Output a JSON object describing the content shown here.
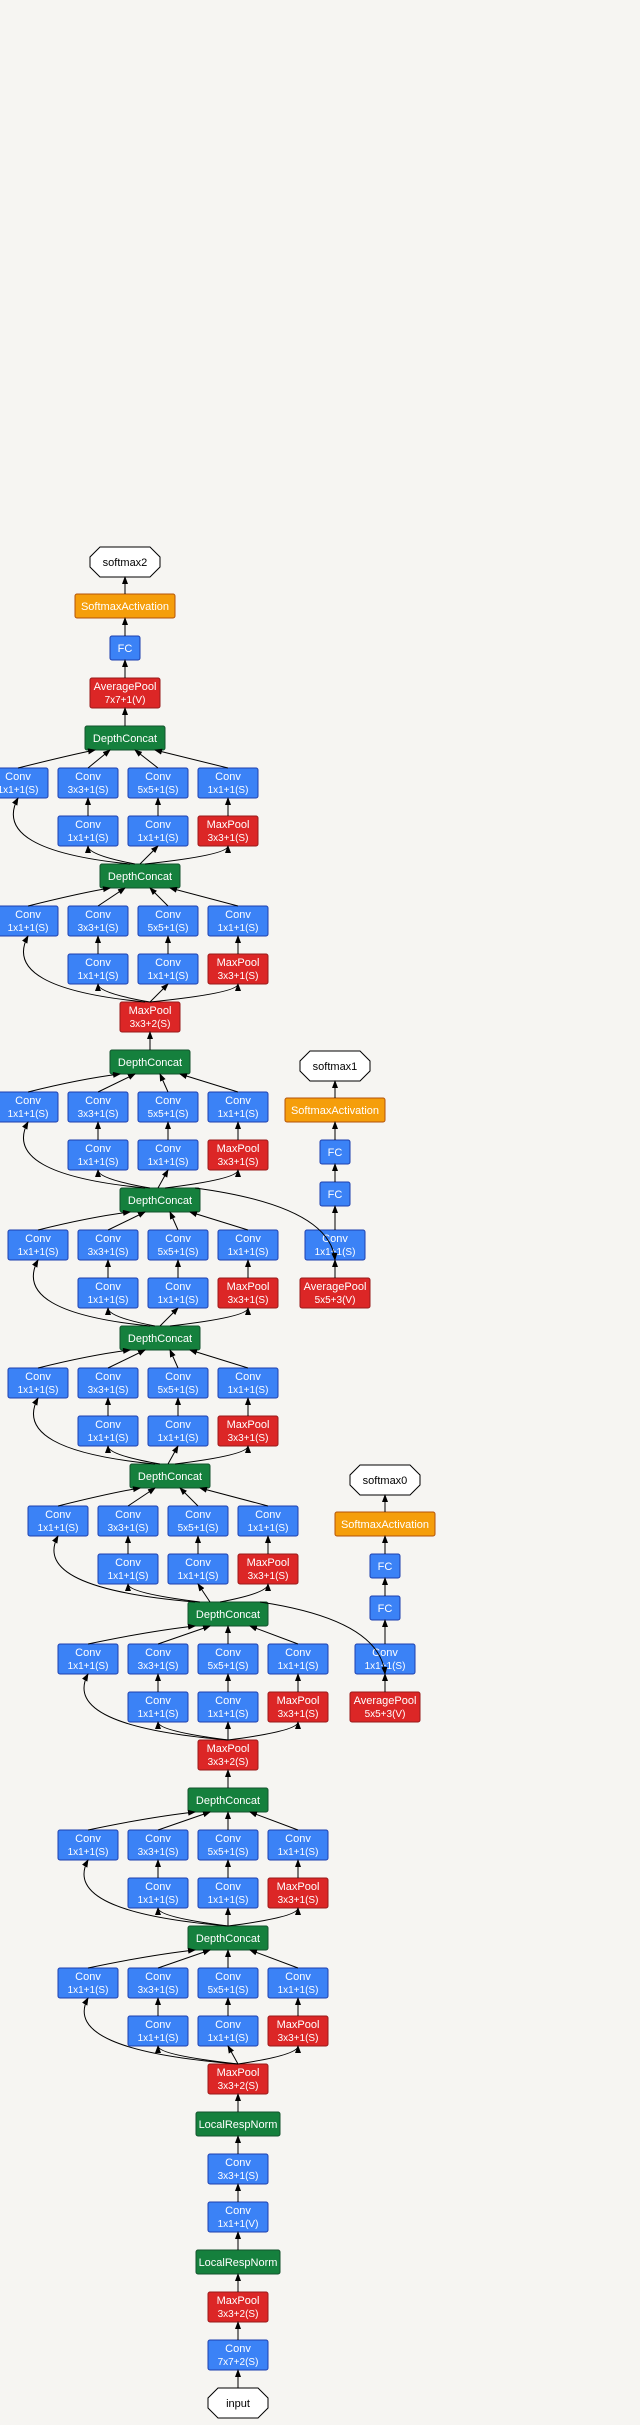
{
  "labels": {
    "input": "input",
    "conv7": "Conv",
    "conv7s": "7x7+2(S)",
    "mp3": "MaxPool",
    "mp3s": "3x3+2(S)",
    "lrn": "LocalRespNorm",
    "conv1": "Conv",
    "conv1s": "1x1+1(V)",
    "conv3": "Conv",
    "conv3s": "3x3+1(S)",
    "dc": "DepthConcat",
    "c1": "Conv",
    "c1s": "1x1+1(S)",
    "c3": "Conv",
    "c3s1": "3x3+1(S)",
    "c5": "Conv",
    "c5s": "5x5+1(S)",
    "mp31": "MaxPool",
    "mp31s": "3x3+1(S)",
    "ap": "AveragePool",
    "aps": "5x5+3(V)",
    "ap7": "AveragePool",
    "ap7s": "7x7+1(V)",
    "fc": "FC",
    "sa": "SoftmaxActivation",
    "sm0": "softmax0",
    "sm1": "softmax1",
    "sm2": "softmax2"
  }
}
